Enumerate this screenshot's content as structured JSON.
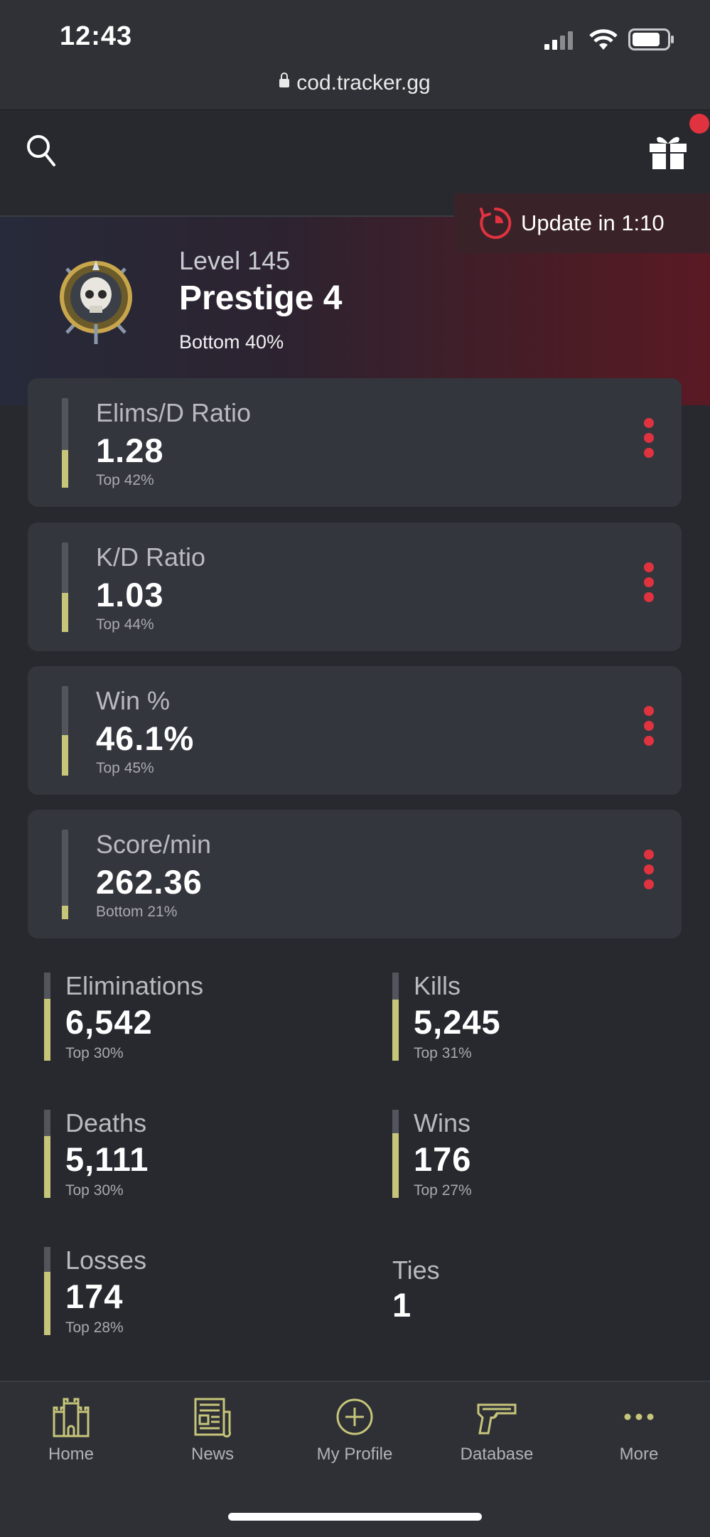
{
  "status_bar": {
    "time": "12:43"
  },
  "browser": {
    "url": "cod.tracker.gg"
  },
  "toast": {
    "text": "Update in 1:10"
  },
  "profile": {
    "level": "Level 145",
    "prestige": "Prestige 4",
    "percentile": "Bottom 40%"
  },
  "cards": [
    {
      "label": "Elims/D Ratio",
      "value": "1.28",
      "percentile": "Top 42%",
      "fill": 0.42
    },
    {
      "label": "K/D Ratio",
      "value": "1.03",
      "percentile": "Top 44%",
      "fill": 0.44
    },
    {
      "label": "Win %",
      "value": "46.1%",
      "percentile": "Top 45%",
      "fill": 0.45
    },
    {
      "label": "Score/min",
      "value": "262.36",
      "percentile": "Bottom 21%",
      "fill": 0.15
    }
  ],
  "stats": [
    {
      "label": "Eliminations",
      "value": "6,542",
      "percentile": "Top 30%",
      "fill": 0.7
    },
    {
      "label": "Kills",
      "value": "5,245",
      "percentile": "Top 31%",
      "fill": 0.69
    },
    {
      "label": "Deaths",
      "value": "5,111",
      "percentile": "Top 30%",
      "fill": 0.7
    },
    {
      "label": "Wins",
      "value": "176",
      "percentile": "Top 27%",
      "fill": 0.73
    },
    {
      "label": "Losses",
      "value": "174",
      "percentile": "Top 28%",
      "fill": 0.72
    },
    {
      "label": "Ties",
      "value": "1"
    }
  ],
  "nav": [
    {
      "label": "Home",
      "icon": "castle-icon"
    },
    {
      "label": "News",
      "icon": "newspaper-icon"
    },
    {
      "label": "My Profile",
      "icon": "plus-circle-icon"
    },
    {
      "label": "Database",
      "icon": "pistol-icon"
    },
    {
      "label": "More",
      "icon": "more-dots-icon"
    }
  ],
  "colors": {
    "accent_red": "#e0333f",
    "bar_fill": "#c6c57a",
    "nav_icon": "#c6c57a"
  }
}
